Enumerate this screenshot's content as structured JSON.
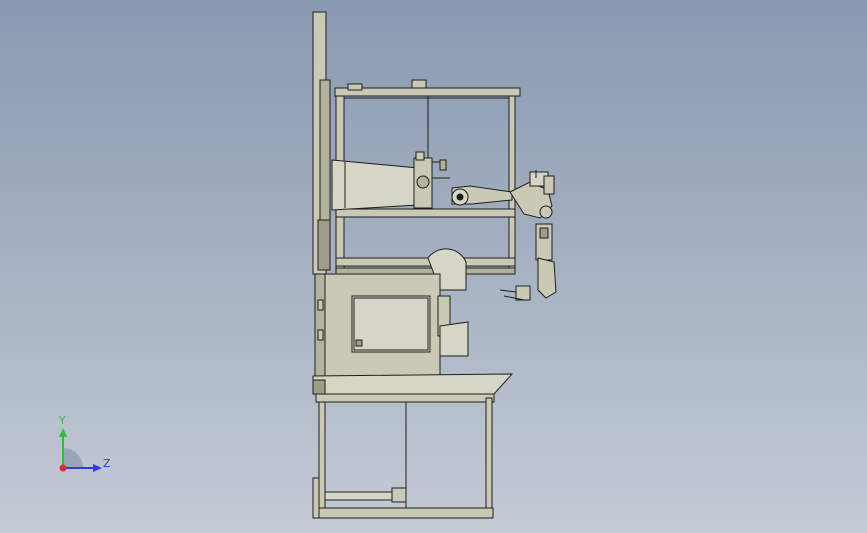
{
  "triad": {
    "y_label": "Y",
    "z_label": "Z"
  },
  "colors": {
    "background_top": "#8a99b2",
    "background_bottom": "#c4cbd5",
    "metal": "#c9c9b6",
    "metal_shade": "#b2b29d",
    "panel": "#d6d6c6",
    "line": "#1e1e1e",
    "axis_y": "#2fbf3a",
    "axis_z": "#2f3fd6",
    "axis_x": "#d62f2f"
  },
  "icons": {
    "viewport": "cad-model-view",
    "triad": "coordinate-triad-icon"
  }
}
